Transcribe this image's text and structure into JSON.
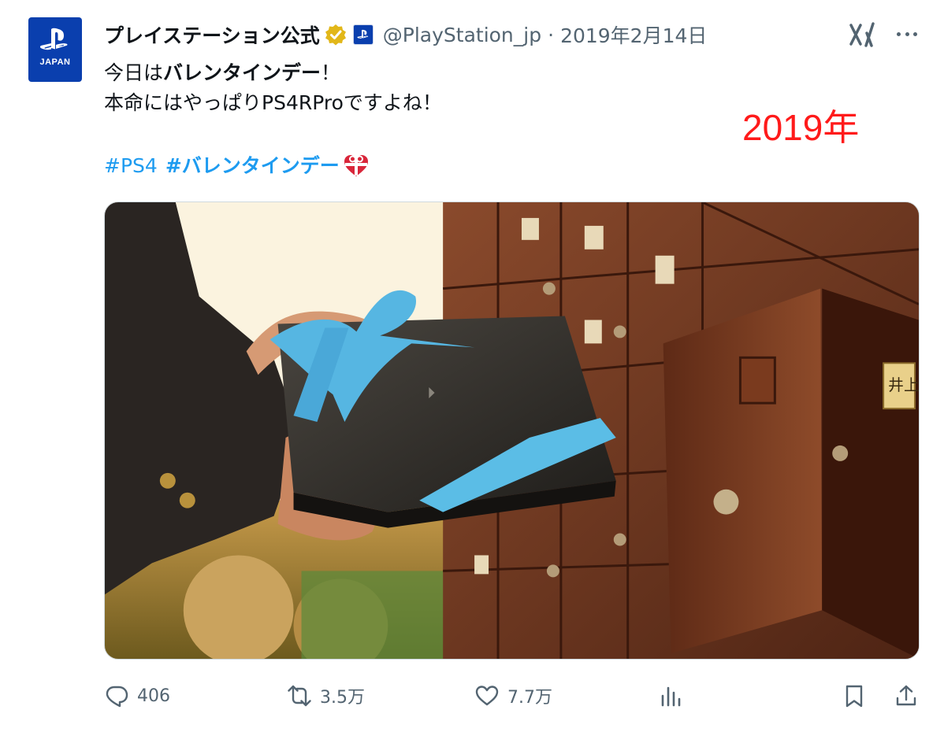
{
  "tweet": {
    "avatar_text": "JAPAN",
    "display_name": "プレイステーション公式",
    "handle": "@PlayStation_jp",
    "separator": "·",
    "date": "2019年2月14日",
    "line1_plain": "今日は",
    "line1_bold": "バレンタインデー",
    "line1_end": "！",
    "line2": "本命にはやっぱりPS4RProですよね！",
    "hashtag1": "#PS4",
    "hashtag2": "#バレンタインデー",
    "annotation": "2019年",
    "photo_locker_label": "井上",
    "actions": {
      "replies": "406",
      "retweets": "3.5万",
      "likes": "7.7万"
    }
  },
  "colors": {
    "link": "#1d9bf0",
    "muted": "#536471",
    "annotation": "#ff1a1a",
    "brand": "#0a3fae"
  },
  "icons": [
    "playstation-logo-icon",
    "verified-badge-icon",
    "affiliate-badge-icon",
    "grok-icon",
    "more-icon",
    "heart-gift-emoji-icon",
    "reply-icon",
    "retweet-icon",
    "like-icon",
    "views-icon",
    "bookmark-icon",
    "share-icon"
  ]
}
